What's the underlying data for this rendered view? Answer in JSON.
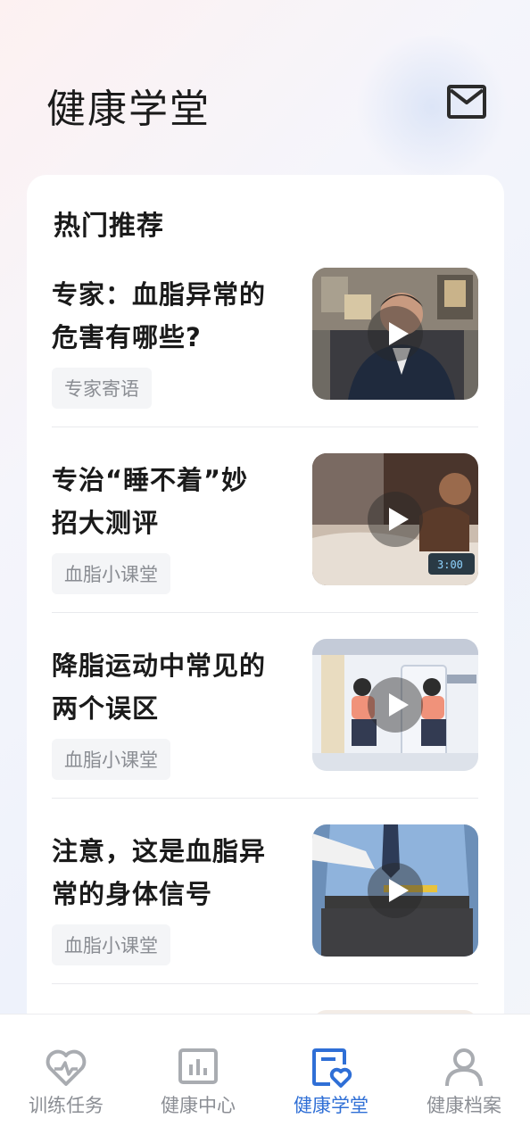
{
  "header": {
    "title": "健康学堂",
    "mail_icon": "mail-icon"
  },
  "card": {
    "section_title": "热门推荐",
    "items": [
      {
        "title": "专家：血脂异常的危害有哪些?",
        "tag": "专家寄语",
        "thumb": "video-expert-interview"
      },
      {
        "title": "专治“睡不着”妙招大测评",
        "tag": "血脂小课堂",
        "thumb": "video-sleepless"
      },
      {
        "title": "降脂运动中常见的两个误区",
        "tag": "血脂小课堂",
        "thumb": "video-exercise"
      },
      {
        "title": "注意，这是血脂异常的身体信号",
        "tag": "血脂小课堂",
        "thumb": "video-waist"
      }
    ]
  },
  "tabbar": {
    "active_color": "#2f6fd6",
    "inactive_color": "#8b8e94",
    "tabs": [
      {
        "label": "训练任务",
        "icon": "heart-pulse-icon"
      },
      {
        "label": "健康中心",
        "icon": "chart-icon"
      },
      {
        "label": "健康学堂",
        "icon": "doc-heart-icon"
      },
      {
        "label": "健康档案",
        "icon": "person-icon"
      }
    ]
  }
}
